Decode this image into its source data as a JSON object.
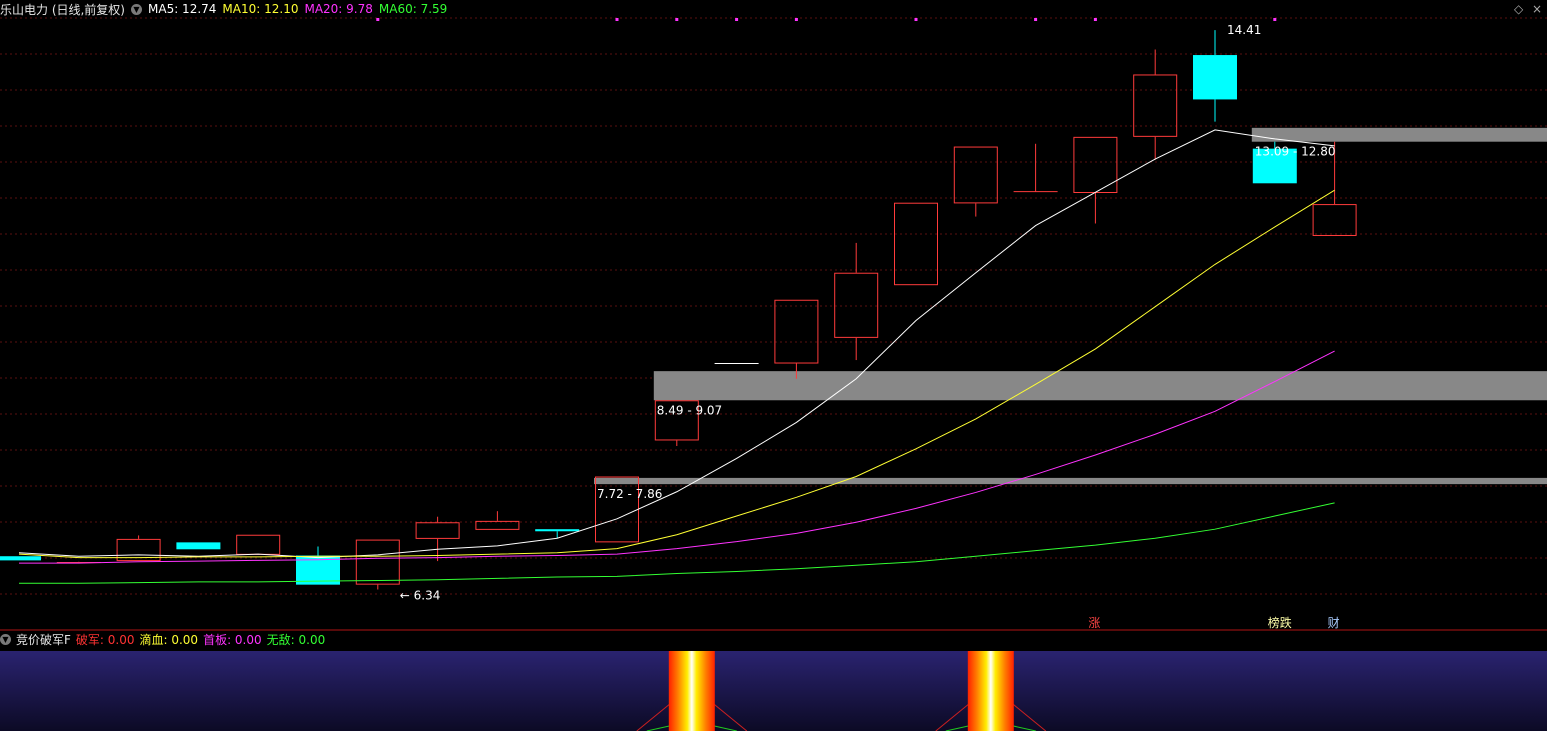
{
  "header": {
    "stock_title": "乐山电力 (日线,前复权)",
    "ma_items": [
      {
        "label": "MA5: 12.74",
        "color": "#ffffff"
      },
      {
        "label": "MA10: 12.10",
        "color": "#ffff33"
      },
      {
        "label": "MA20: 9.78",
        "color": "#ff33ff"
      },
      {
        "label": "MA60: 7.59",
        "color": "#33ff33"
      }
    ]
  },
  "window_controls": {
    "diamond": "◇",
    "close": "×"
  },
  "sub_header": {
    "indicator_name": "竞价破军F",
    "items": [
      {
        "label": "破军: 0.00",
        "color": "#ff3333"
      },
      {
        "label": "滴血: 0.00",
        "color": "#ffff33"
      },
      {
        "label": "首板: 0.00",
        "color": "#ff33ff"
      },
      {
        "label": "无敌: 0.00",
        "color": "#33ff33"
      }
    ]
  },
  "event_tags": [
    {
      "text": "涨",
      "color": "#ff4444",
      "index": 18
    },
    {
      "text": "榜跌",
      "color": "#ffffaa",
      "index": 21
    },
    {
      "text": "财",
      "color": "#aaccff",
      "index": 22
    }
  ],
  "chart_data": {
    "type": "candlestick",
    "price_axis": {
      "min": 5.9,
      "max": 14.7
    },
    "candles": [
      {
        "o": 6.82,
        "c": 6.76,
        "h": 6.82,
        "l": 6.76
      },
      {
        "o": 6.72,
        "c": 6.73,
        "h": 6.74,
        "l": 6.72
      },
      {
        "o": 6.75,
        "c": 7.07,
        "h": 7.12,
        "l": 6.75
      },
      {
        "o": 7.02,
        "c": 6.92,
        "h": 7.02,
        "l": 6.92
      },
      {
        "o": 6.84,
        "c": 7.13,
        "h": 7.13,
        "l": 6.84
      },
      {
        "o": 6.83,
        "c": 6.41,
        "h": 6.96,
        "l": 6.41
      },
      {
        "o": 6.41,
        "c": 7.06,
        "h": 7.06,
        "l": 6.34
      },
      {
        "o": 7.07,
        "c": 7.31,
        "h": 7.39,
        "l": 6.75
      },
      {
        "o": 7.2,
        "c": 7.33,
        "h": 7.47,
        "l": 7.2
      },
      {
        "o": 7.21,
        "c": 7.18,
        "h": 7.21,
        "l": 7.08
      },
      {
        "o": 7.02,
        "c": 7.97,
        "h": 7.97,
        "l": 7.02
      },
      {
        "o": 8.49,
        "c": 9.07,
        "h": 9.07,
        "l": 8.41
      },
      {
        "o": 9.6,
        "c": 9.6,
        "h": 9.6,
        "l": 9.6
      },
      {
        "o": 9.6,
        "c": 10.52,
        "h": 10.52,
        "l": 9.38
      },
      {
        "o": 9.97,
        "c": 10.91,
        "h": 11.34,
        "l": 9.65
      },
      {
        "o": 10.73,
        "c": 11.92,
        "h": 11.92,
        "l": 10.73
      },
      {
        "o": 11.91,
        "c": 12.73,
        "h": 12.73,
        "l": 11.72
      },
      {
        "o": 12.06,
        "c": 12.08,
        "h": 12.77,
        "l": 12.06
      },
      {
        "o": 12.06,
        "c": 12.87,
        "h": 12.87,
        "l": 11.62
      },
      {
        "o": 12.87,
        "c": 13.77,
        "h": 14.13,
        "l": 12.54
      },
      {
        "o": 14.05,
        "c": 13.41,
        "h": 14.41,
        "l": 13.09
      },
      {
        "o": 12.7,
        "c": 12.2,
        "h": 12.8,
        "l": 12.2
      },
      {
        "o": 11.44,
        "c": 11.9,
        "h": 12.8,
        "l": 11.44
      }
    ],
    "moving_averages": [
      {
        "name": "MA5",
        "color": "#ffffff",
        "start": 0,
        "values": [
          6.87,
          6.82,
          6.84,
          6.82,
          6.85,
          6.8,
          6.84,
          6.92,
          6.97,
          7.08,
          7.36,
          7.75,
          8.23,
          8.75,
          9.38,
          10.22,
          10.91,
          11.59,
          12.07,
          12.55,
          12.97,
          12.84,
          12.74
        ]
      },
      {
        "name": "MA10",
        "color": "#ffff33",
        "start": 0,
        "values": [
          6.85,
          6.8,
          6.8,
          6.81,
          6.81,
          6.82,
          6.82,
          6.83,
          6.85,
          6.87,
          6.93,
          7.13,
          7.4,
          7.67,
          7.97,
          8.37,
          8.8,
          9.3,
          9.81,
          10.42,
          11.03,
          11.57,
          12.1
        ]
      },
      {
        "name": "MA20",
        "color": "#ff33ff",
        "start": 0,
        "values": [
          6.72,
          6.72,
          6.74,
          6.75,
          6.76,
          6.77,
          6.79,
          6.8,
          6.82,
          6.83,
          6.85,
          6.93,
          7.03,
          7.15,
          7.31,
          7.51,
          7.74,
          8.0,
          8.28,
          8.58,
          8.91,
          9.34,
          9.78
        ]
      },
      {
        "name": "MA60",
        "color": "#33ff33",
        "start": 0,
        "values": [
          6.43,
          6.43,
          6.44,
          6.45,
          6.45,
          6.46,
          6.47,
          6.48,
          6.5,
          6.52,
          6.53,
          6.57,
          6.6,
          6.64,
          6.69,
          6.74,
          6.82,
          6.9,
          6.98,
          7.08,
          7.21,
          7.4,
          7.59
        ]
      }
    ],
    "gap_zones": [
      {
        "from_index": 11,
        "low": 9.07,
        "high": 9.49,
        "label": "8.49 - 9.07"
      },
      {
        "from_index": 10,
        "low": 7.86,
        "high": 7.95,
        "label": "7.72 - 7.86"
      },
      {
        "from_index": 21,
        "low": 12.8,
        "high": 13.0,
        "label": "13.09 - 12.80"
      }
    ],
    "annotations": [
      {
        "index": 20,
        "price": 14.41,
        "text": "14.41"
      },
      {
        "index": 6,
        "price": 6.34,
        "text": "← 6.34"
      }
    ],
    "signal_dots_indices": [
      6,
      10,
      11,
      12,
      13,
      15,
      17,
      18,
      21
    ],
    "sub_indicator": {
      "name": "竞价破军F",
      "signal_indices": [
        11,
        16
      ]
    }
  }
}
